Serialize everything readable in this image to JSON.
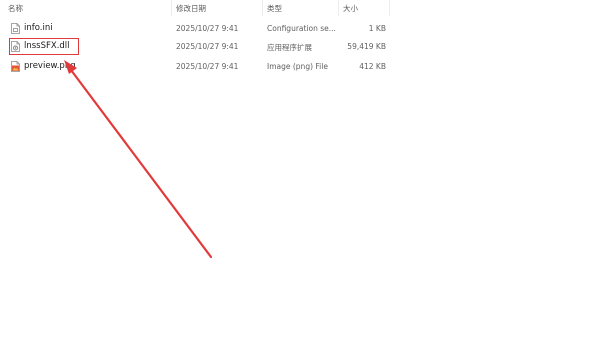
{
  "columns": {
    "name": "名称",
    "date": "修改日期",
    "type": "类型",
    "size": "大小"
  },
  "files": [
    {
      "name": "info.ini",
      "date": "2025/10/27 9:41",
      "type": "Configuration se...",
      "size": "1 KB",
      "icon": "ini-file-icon"
    },
    {
      "name": "lnssSFX.dll",
      "date": "2025/10/27 9:41",
      "type": "应用程序扩展",
      "size": "59,419 KB",
      "icon": "dll-file-icon",
      "highlighted": true
    },
    {
      "name": "preview.png",
      "date": "2025/10/27 9:41",
      "type": "Image (png) File",
      "size": "412 KB",
      "icon": "png-file-icon"
    }
  ],
  "colors": {
    "annotation": "#e23a3a",
    "header_text": "#5a5a5a"
  }
}
